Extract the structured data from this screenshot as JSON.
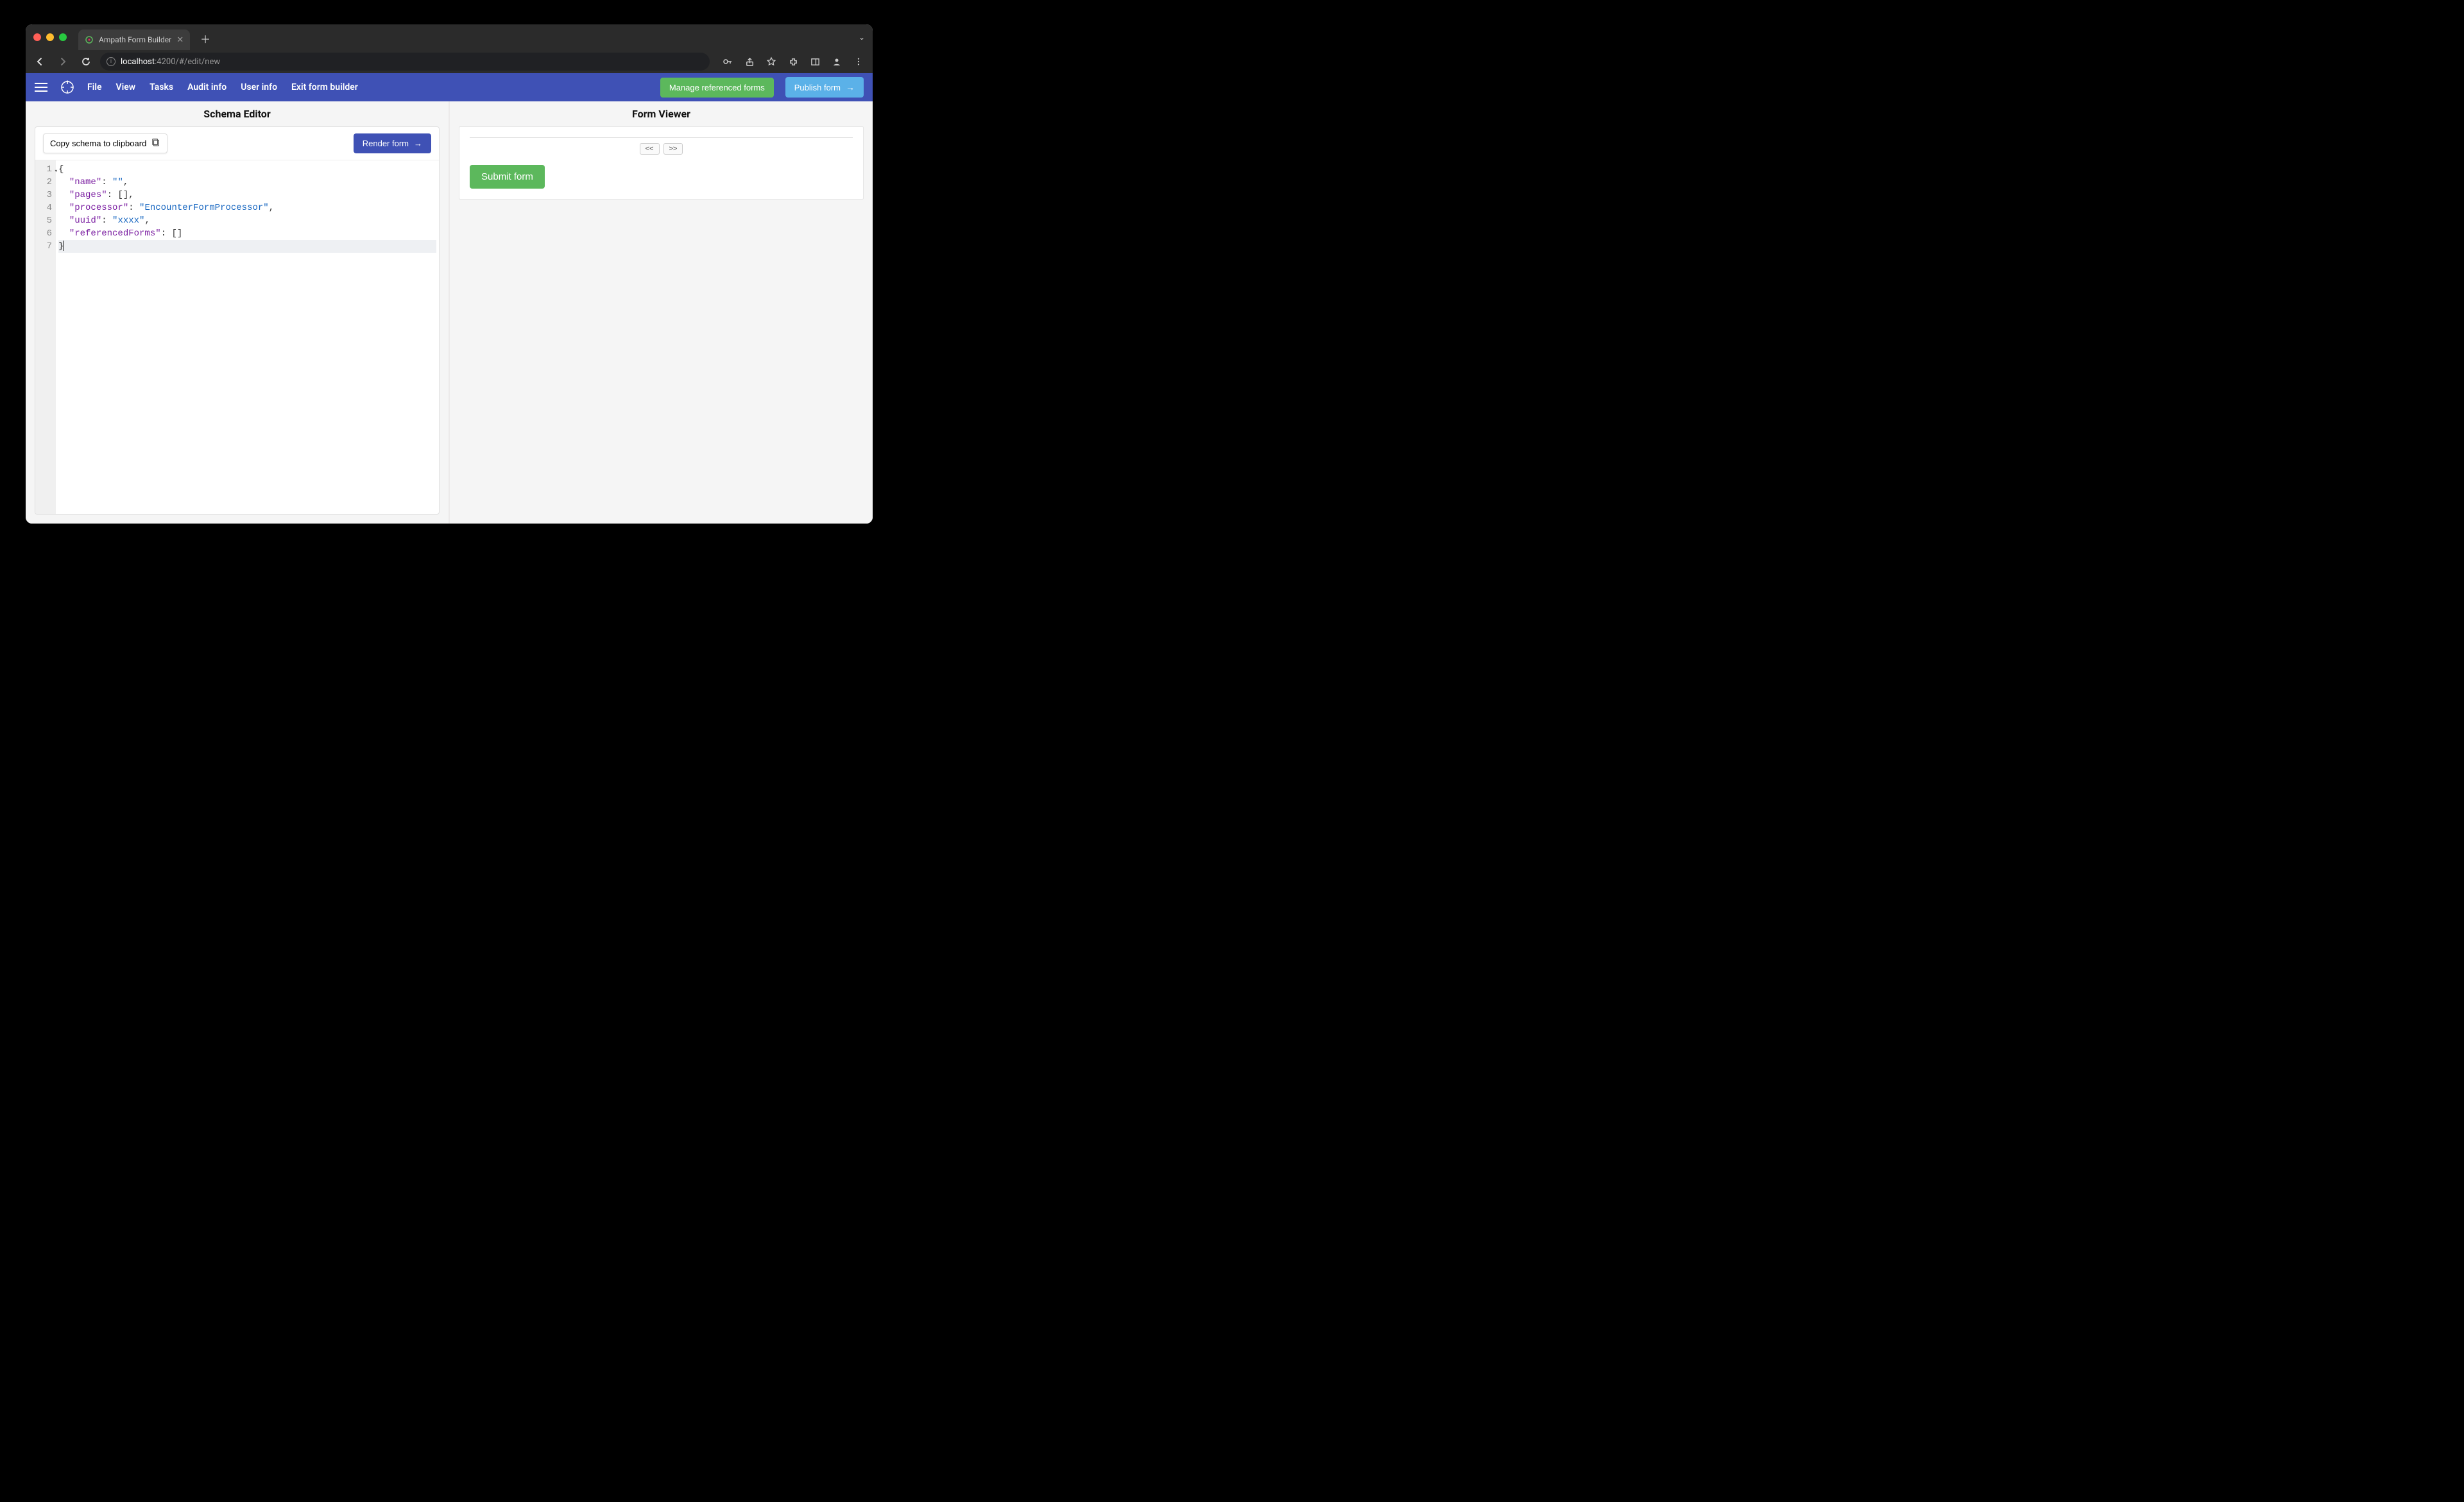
{
  "browser": {
    "tab_title": "Ampath Form Builder",
    "url_host": "localhost",
    "url_port": ":4200",
    "url_path": "/#/edit/new"
  },
  "toolbar": {
    "menu": [
      "File",
      "View",
      "Tasks",
      "Audit info",
      "User info",
      "Exit form builder"
    ],
    "manage_refs_label": "Manage referenced forms",
    "publish_label": "Publish form"
  },
  "editor": {
    "panel_title": "Schema Editor",
    "copy_label": "Copy schema to clipboard",
    "render_label": "Render form",
    "line_numbers": [
      "1",
      "2",
      "3",
      "4",
      "5",
      "6",
      "7"
    ],
    "code_lines": [
      {
        "indent": 0,
        "tokens": [
          {
            "t": "punc",
            "v": "{"
          }
        ]
      },
      {
        "indent": 1,
        "tokens": [
          {
            "t": "key",
            "v": "\"name\""
          },
          {
            "t": "punc",
            "v": ": "
          },
          {
            "t": "str",
            "v": "\"\""
          },
          {
            "t": "punc",
            "v": ","
          }
        ]
      },
      {
        "indent": 1,
        "tokens": [
          {
            "t": "key",
            "v": "\"pages\""
          },
          {
            "t": "punc",
            "v": ": []"
          },
          {
            "t": "punc",
            "v": ","
          }
        ]
      },
      {
        "indent": 1,
        "tokens": [
          {
            "t": "key",
            "v": "\"processor\""
          },
          {
            "t": "punc",
            "v": ": "
          },
          {
            "t": "str",
            "v": "\"EncounterFormProcessor\""
          },
          {
            "t": "punc",
            "v": ","
          }
        ]
      },
      {
        "indent": 1,
        "tokens": [
          {
            "t": "key",
            "v": "\"uuid\""
          },
          {
            "t": "punc",
            "v": ": "
          },
          {
            "t": "str",
            "v": "\"xxxx\""
          },
          {
            "t": "punc",
            "v": ","
          }
        ]
      },
      {
        "indent": 1,
        "tokens": [
          {
            "t": "key",
            "v": "\"referencedForms\""
          },
          {
            "t": "punc",
            "v": ": []"
          }
        ]
      },
      {
        "indent": 0,
        "tokens": [
          {
            "t": "punc",
            "v": "}"
          }
        ],
        "highlight": true,
        "cursor": true
      }
    ]
  },
  "viewer": {
    "panel_title": "Form Viewer",
    "prev_label": "<<",
    "next_label": ">>",
    "submit_label": "Submit form"
  }
}
